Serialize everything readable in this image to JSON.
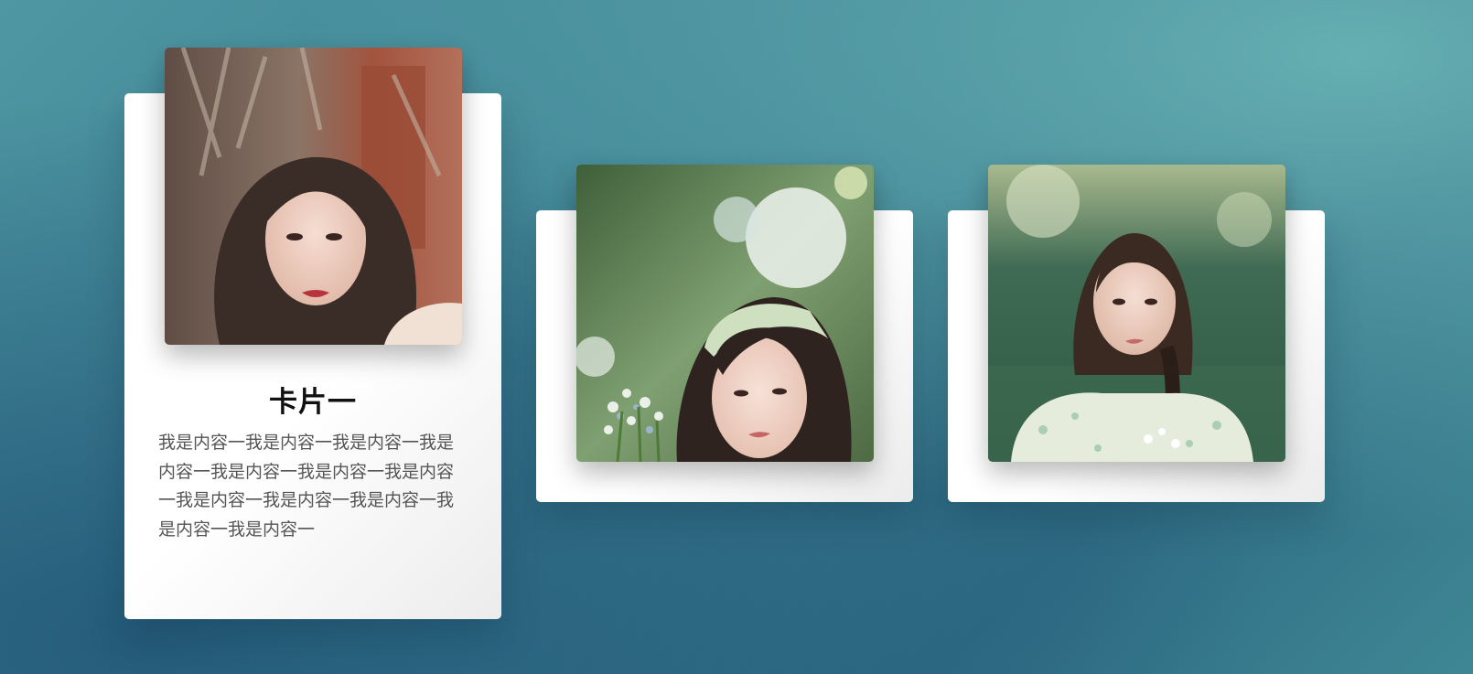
{
  "cards": [
    {
      "title": "卡片一",
      "body": "我是内容一我是内容一我是内容一我是内容一我是内容一我是内容一我是内容一我是内容一我是内容一我是内容一我是内容一我是内容一",
      "image": "portrait-photo-woman-long-hair"
    },
    {
      "image": "portrait-photo-woman-headband"
    },
    {
      "image": "portrait-photo-woman-braid"
    }
  ]
}
